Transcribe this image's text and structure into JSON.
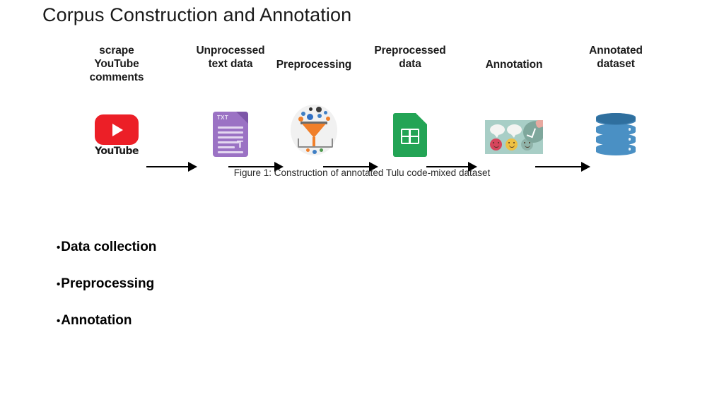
{
  "slide": {
    "title": "Corpus Construction and Annotation",
    "caption": "Figure 1: Construction of annotated Tulu code-mixed dataset"
  },
  "pipeline": {
    "stages": [
      {
        "label": "scrape\nYouTube\ncomments",
        "label_lines": [
          "scrape",
          "YouTube",
          "comments"
        ],
        "icon": "youtube-logo-icon",
        "wordmark": "YouTube"
      },
      {
        "label": "Unprocessed\ntext data",
        "label_lines": [
          "Unprocessed",
          "text data"
        ],
        "icon": "txt-document-icon",
        "file_type": "TXT",
        "glyph": "T"
      },
      {
        "label": "Preprocessing",
        "label_lines": [
          "Preprocessing"
        ],
        "icon": "funnel-filter-icon"
      },
      {
        "label": "Preprocessed\ndata",
        "label_lines": [
          "Preprocessed",
          "data"
        ],
        "icon": "spreadsheet-icon"
      },
      {
        "label": "Annotation",
        "label_lines": [
          "Annotation"
        ],
        "icon": "annotation-labeling-icon"
      },
      {
        "label": "Annotated\ndataset",
        "label_lines": [
          "Annotated",
          "dataset"
        ],
        "icon": "database-icon"
      }
    ],
    "arrow_count": 5
  },
  "bullets": [
    {
      "mark": "•",
      "text": "Data collection"
    },
    {
      "mark": "•",
      "text": "Preprocessing"
    },
    {
      "mark": "•",
      "text": "Annotation"
    }
  ],
  "colors": {
    "youtube_red": "#ec1f27",
    "txt_purple": "#9b72c4",
    "funnel_orange": "#f07f2a",
    "sheets_green": "#23a455",
    "annotation_teal": "#a8cec6",
    "database_blue": "#4a90c4",
    "text_black": "#1a1a1a"
  }
}
